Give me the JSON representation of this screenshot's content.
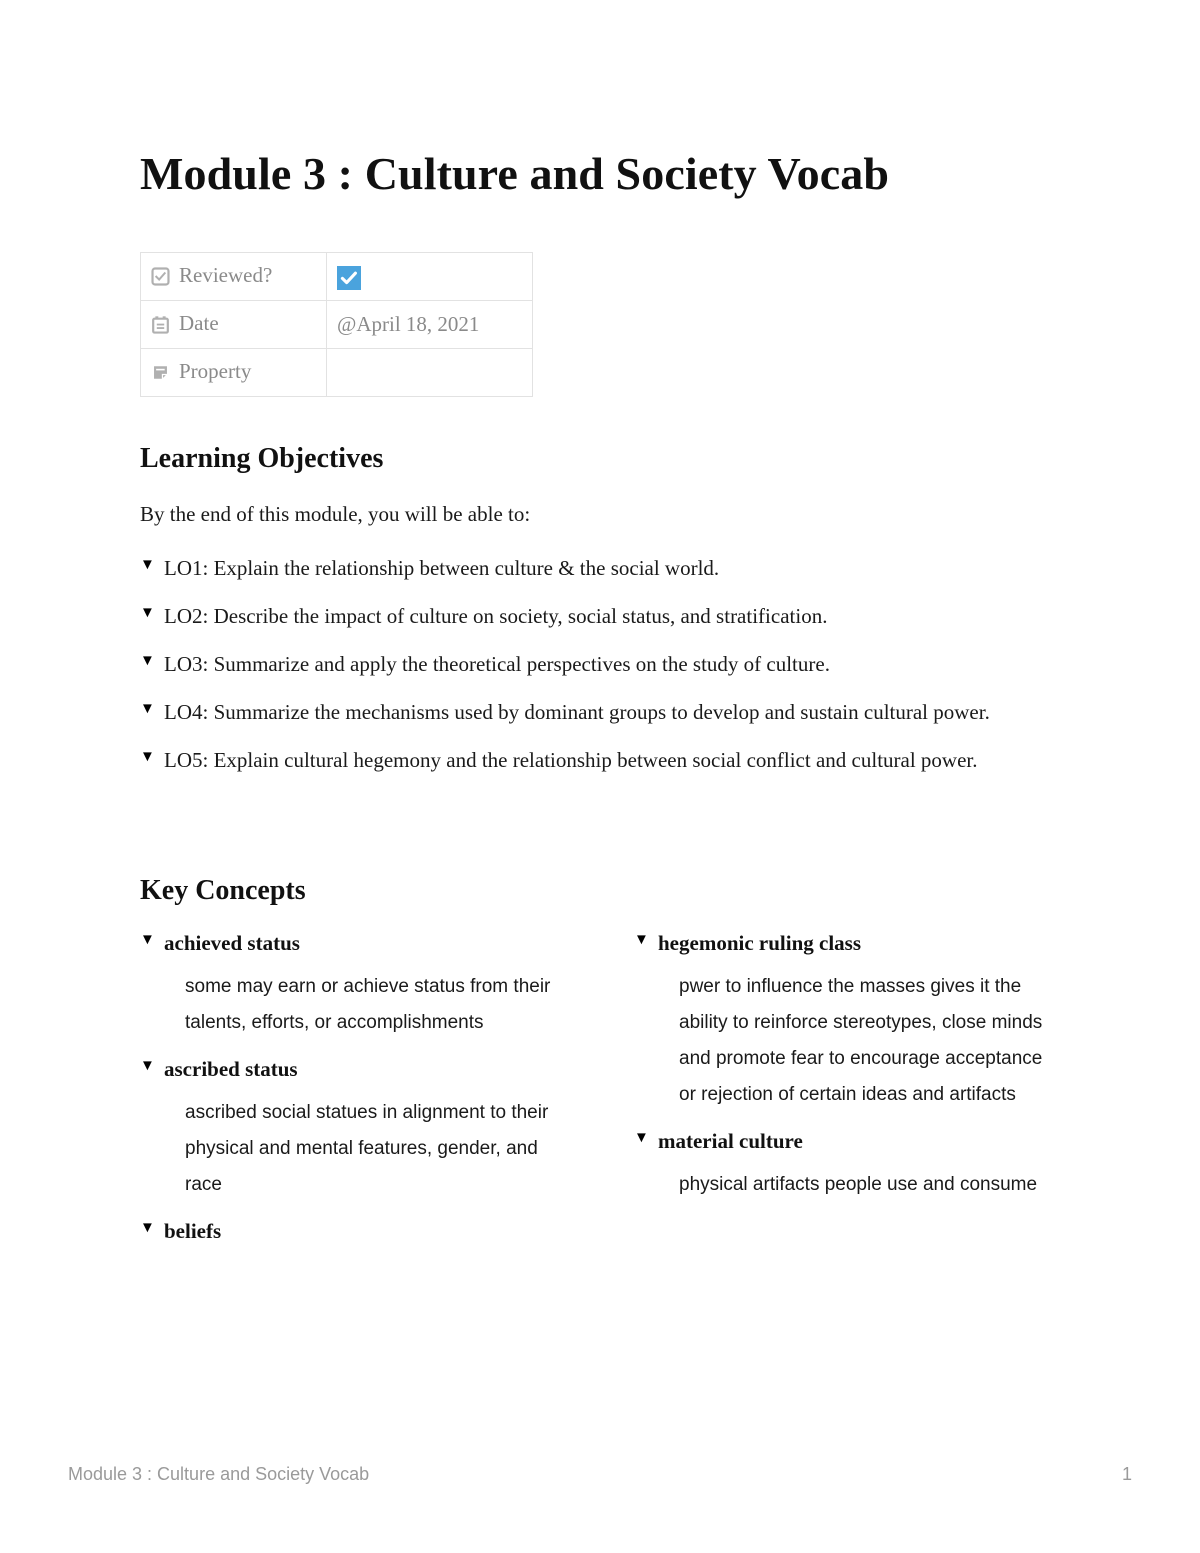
{
  "document": {
    "title": "Module 3 : Culture and Society Vocab"
  },
  "properties": {
    "rows": [
      {
        "icon": "checkbox-icon",
        "label": "Reviewed?",
        "value_type": "checkbox",
        "value": "checked"
      },
      {
        "icon": "calendar-icon",
        "label": "Date",
        "value_type": "text",
        "value": "@April 18, 2021"
      },
      {
        "icon": "text-property-icon",
        "label": "Property",
        "value_type": "text",
        "value": ""
      }
    ]
  },
  "learning_objectives": {
    "heading": "Learning Objectives",
    "intro": "By the end of this module, you will be able to:",
    "caret": "▼",
    "items": [
      "LO1: Explain the relationship between culture & the social world.",
      "LO2: Describe the impact of culture on society, social status, and stratification.",
      "LO3: Summarize and apply the theoretical perspectives on the study of culture.",
      "LO4: Summarize the mechanisms used by dominant groups to develop and sustain cultural power.",
      "LO5: Explain cultural hegemony and the relationship between social conflict and cultural power."
    ]
  },
  "key_concepts": {
    "heading": "Key Concepts",
    "caret": "▼",
    "left_column": [
      {
        "term": "achieved status",
        "definition": "some may earn or achieve status from their talents, efforts, or accomplishments"
      },
      {
        "term": "ascribed status",
        "definition": "ascribed social statues in alignment to their physical and mental features, gender, and race"
      },
      {
        "term": "beliefs",
        "definition": ""
      }
    ],
    "right_column": [
      {
        "term": "hegemonic ruling class",
        "definition": "pwer to influence the masses gives it the ability to reinforce stereotypes, close minds and promote fear to encourage acceptance or rejection of certain ideas and artifacts"
      },
      {
        "term": "material culture",
        "definition": "physical artifacts people use and consume"
      }
    ]
  },
  "footer": {
    "left": "Module 3 : Culture and Society Vocab",
    "page_number": "1"
  },
  "colors": {
    "checkbox_accent": "#4aa3dd",
    "property_icon_gray": "#b0b0b0",
    "property_label_gray": "#8a8a8a",
    "table_border": "#e2e2e2",
    "footer_gray": "#9a9a9a",
    "body_text": "#1a1a1a"
  }
}
